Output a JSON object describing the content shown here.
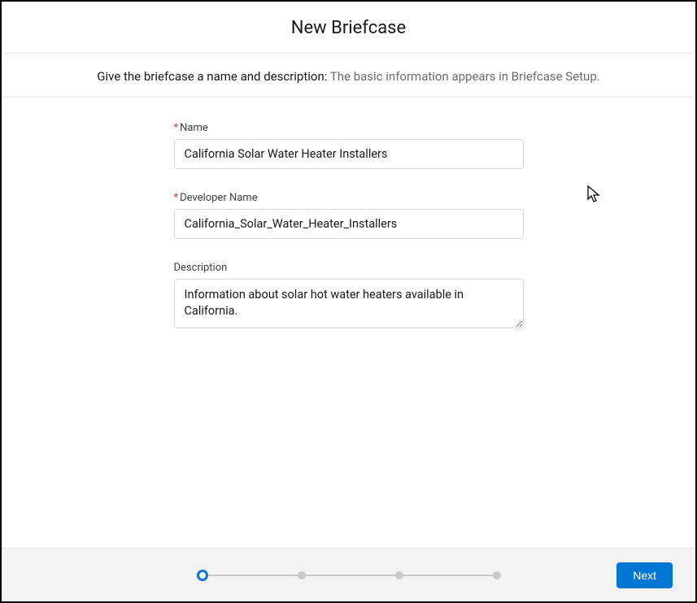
{
  "header": {
    "title": "New Briefcase"
  },
  "subheader": {
    "lead": "Give the briefcase a name and description: ",
    "hint": "The basic information appears in Briefcase Setup."
  },
  "form": {
    "name": {
      "label": "Name",
      "required_marker": "*",
      "value": "California Solar Water Heater Installers"
    },
    "developer_name": {
      "label": "Developer Name",
      "required_marker": "*",
      "value": "California_Solar_Water_Heater_Installers"
    },
    "description": {
      "label": "Description",
      "value": "Information about solar hot water heaters available in California."
    }
  },
  "footer": {
    "next_label": "Next",
    "steps": {
      "total": 4,
      "current": 1
    }
  }
}
